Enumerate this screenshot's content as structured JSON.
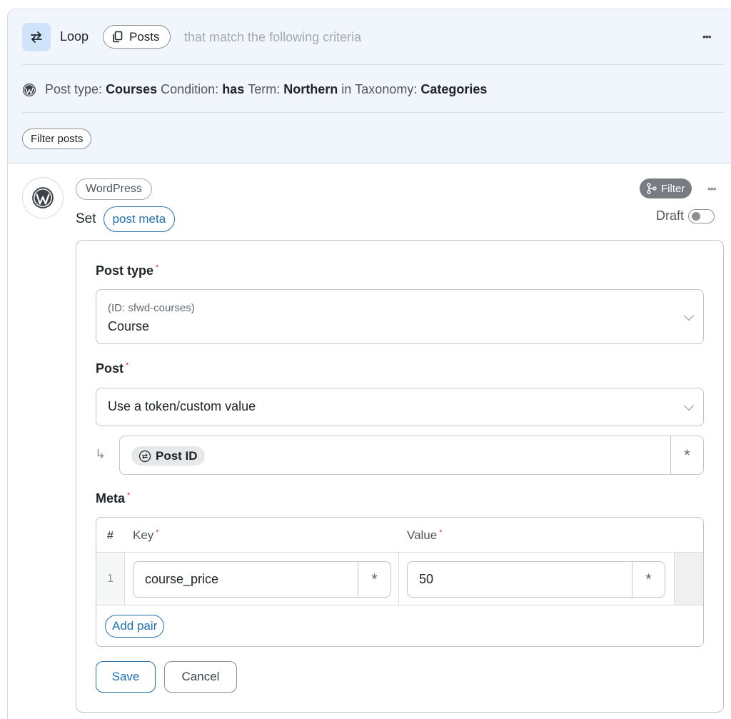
{
  "loop": {
    "title": "Loop",
    "posts_pill": "Posts",
    "criteria_text": "that match the following criteria",
    "more": "•••",
    "condition": {
      "post_type_label": "Post type:",
      "post_type_value": "Courses",
      "condition_label": "Condition:",
      "condition_value": "has",
      "term_label": "Term:",
      "term_value": "Northern",
      "in_label": "in",
      "taxonomy_label": "Taxonomy:",
      "taxonomy_value": "Categories"
    },
    "filter_posts": "Filter posts"
  },
  "step": {
    "integration": "WordPress",
    "set_label": "Set",
    "meta_pill": "post meta",
    "filter_badge": "Filter",
    "more": "•••",
    "draft_label": "Draft",
    "draft_enabled": false
  },
  "form": {
    "post_type": {
      "label": "Post type",
      "required": "*",
      "id_hint": "(ID: sfwd-courses)",
      "value": "Course"
    },
    "post": {
      "label": "Post",
      "required": "*",
      "value": "Use a token/custom value",
      "arrow": "↳",
      "token": "Post ID",
      "token_button": "*"
    },
    "meta": {
      "label": "Meta",
      "required": "*",
      "columns": {
        "hash": "#",
        "key": "Key",
        "value": "Value",
        "required": "*"
      },
      "rows": [
        {
          "num": "1",
          "key": "course_price",
          "value": "50",
          "key_button": "*",
          "value_button": "*"
        }
      ],
      "add_pair": "Add pair"
    },
    "save": "Save",
    "cancel": "Cancel"
  },
  "colors": {
    "accent": "#2271b1",
    "header_bg": "#f0f6fc",
    "loop_icon_bg": "#cfe4fb",
    "required": "#d63638"
  }
}
